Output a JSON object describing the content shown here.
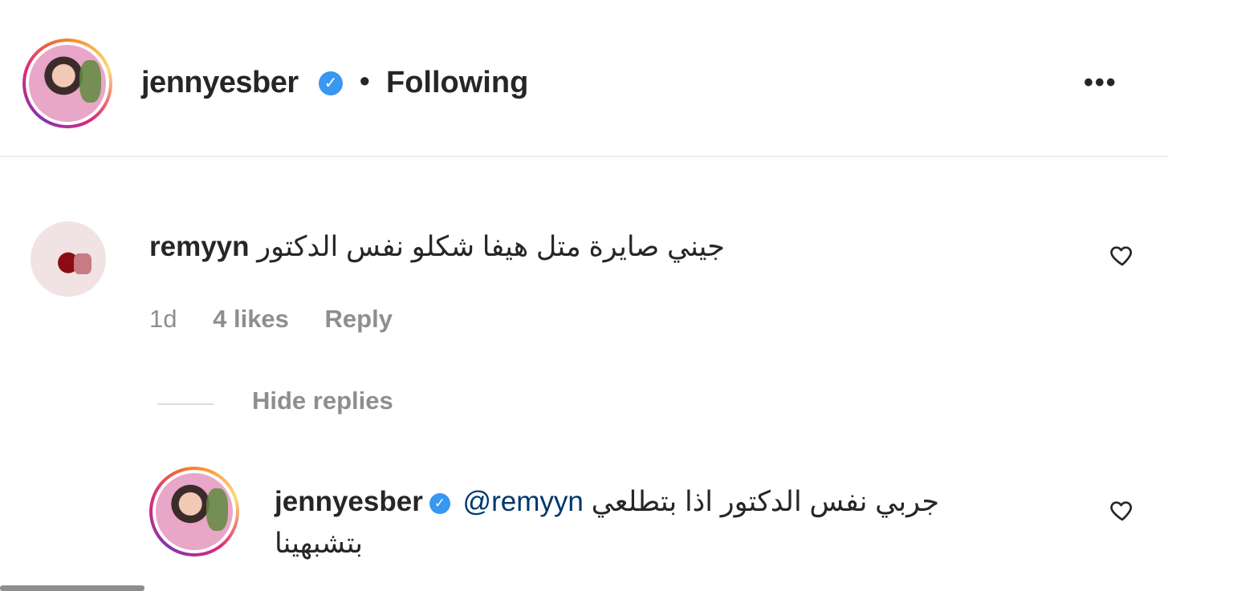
{
  "header": {
    "username": "jennyesber",
    "separator": "•",
    "follow_status": "Following",
    "more_label": "•••"
  },
  "comment": {
    "username": "remyyn",
    "text": "جيني صايرة متل هيفا شكلو نفس الدكتور",
    "time": "1d",
    "likes": "4 likes",
    "reply_label": "Reply"
  },
  "replies_toggle": {
    "label": "Hide replies"
  },
  "reply": {
    "username": "jennyesber",
    "mention": "@remyyn",
    "text_line1": "جربي نفس الدكتور اذا بتطلعي",
    "text_line2": "بتشبهينا"
  },
  "icons": {
    "verified": "verified-badge-icon",
    "like": "heart-outline-icon",
    "more": "more-horizontal-icon"
  },
  "colors": {
    "verified": "#3897f0",
    "mention": "#00376b",
    "meta": "#8e8e8e"
  }
}
